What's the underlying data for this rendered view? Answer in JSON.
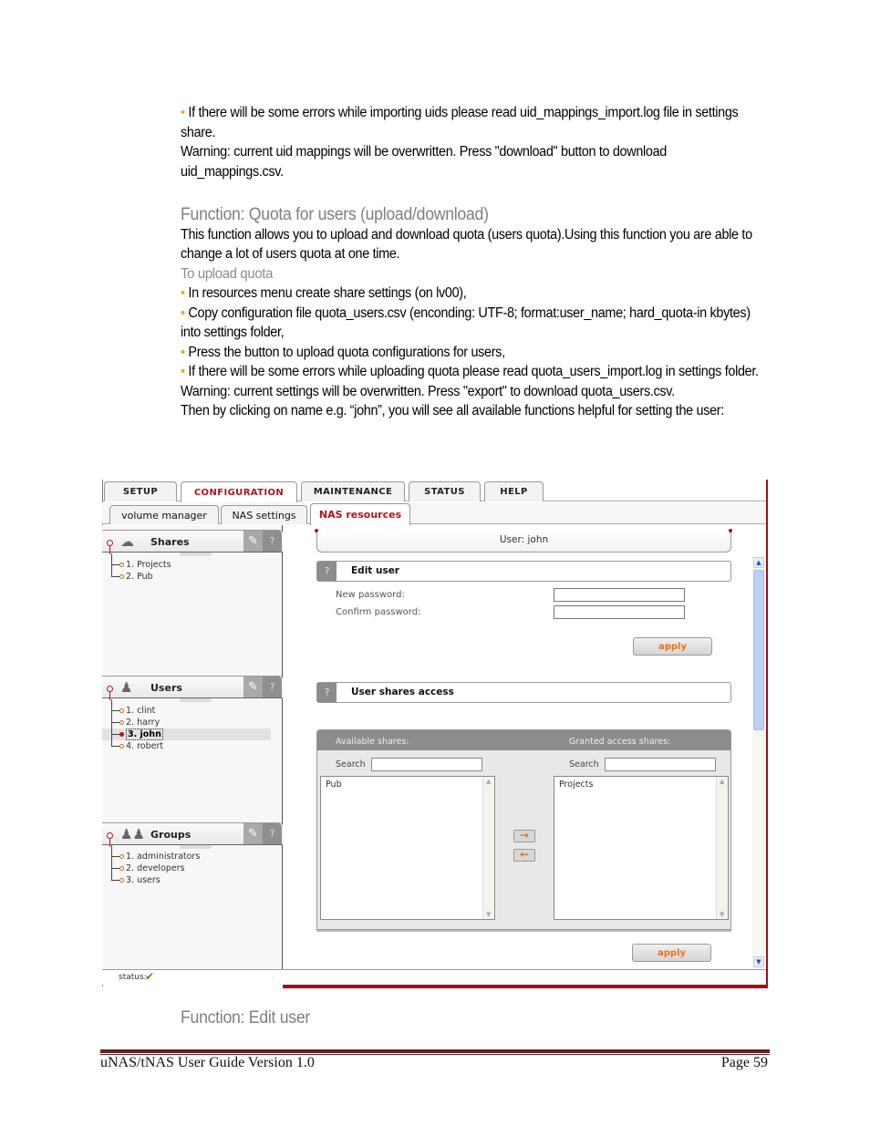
{
  "doc": {
    "intro": {
      "bullet_uid_errors": "If there will be some errors while importing uids please read uid_mappings_import.log file in settings share.",
      "warning_uid": "Warning: current uid mappings will be overwritten. Press \"download\" button to download uid_mappings.csv."
    },
    "quota_section": {
      "heading": "Function: Quota for users (upload/download)",
      "description": "This function allows you to upload and download quota (users quota).Using this function you are able to change a lot of users quota at one time.",
      "subheading": "To upload quota",
      "bullets": [
        "In resources menu create share settings (on lv00),",
        "Copy configuration file quota_users.csv (enconding: UTF-8; format:user_name; hard_quota-in kbytes) into settings folder,",
        "Press the button to upload quota configurations for users,",
        "If there will be some errors while uploading quota please read quota_users_import.log in settings folder."
      ],
      "warning": "Warning: current settings will be overwritten. Press \"export\" to download quota_users.csv.",
      "then_text": "Then by clicking on name e.g. “john”, you will see all available functions helpful for setting the user:"
    },
    "edit_user_heading": "Function: Edit user",
    "footer": {
      "left": "uNAS/tNAS User Guide Version 1.0",
      "right": "Page 59"
    }
  },
  "app": {
    "main_tabs": [
      {
        "label": "SETUP",
        "active": false
      },
      {
        "label": "CONFIGURATION",
        "active": true
      },
      {
        "label": "MAINTENANCE",
        "active": false
      },
      {
        "label": "STATUS",
        "active": false
      },
      {
        "label": "HELP",
        "active": false
      }
    ],
    "sub_tabs": [
      {
        "label": "volume manager",
        "active": false
      },
      {
        "label": "NAS settings",
        "active": false
      },
      {
        "label": "NAS resources",
        "active": true
      }
    ],
    "sidebar": {
      "shares": {
        "title": "Shares",
        "icon": "share-icon",
        "items": [
          "1. Projects",
          "2. Pub"
        ]
      },
      "users": {
        "title": "Users",
        "icon": "user-icon",
        "items": [
          "1. clint",
          "2. harry",
          "3. john",
          "4. robert"
        ],
        "selected": "3. john"
      },
      "groups": {
        "title": "Groups",
        "icon": "group-icon",
        "items": [
          "1. administrators",
          "2. developers",
          "3. users"
        ]
      },
      "wrench_glyph": "✎",
      "help_glyph": "?"
    },
    "content": {
      "user_title": "User: john",
      "edit_user": {
        "title": "Edit user",
        "help_glyph": "?",
        "new_password_label": "New password:",
        "new_password_value": "",
        "confirm_password_label": "Confirm password:",
        "confirm_password_value": "",
        "apply_label": "apply"
      },
      "shares_access": {
        "title": "User shares access",
        "help_glyph": "?",
        "available_label": "Available shares:",
        "granted_label": "Granted access shares:",
        "search_label": "Search",
        "available_search_value": "",
        "granted_search_value": "",
        "available_items": [
          "Pub"
        ],
        "granted_items": [
          "Projects"
        ],
        "add_glyph": "→",
        "remove_glyph": "←",
        "apply_label": "apply"
      }
    },
    "status": {
      "label": "status:",
      "glyph": "✔"
    },
    "colors": {
      "accent_red": "#b5121b",
      "apply_orange": "#e8731c",
      "bullet_orange": "#f5a623",
      "footer_rule": "#622423"
    }
  }
}
